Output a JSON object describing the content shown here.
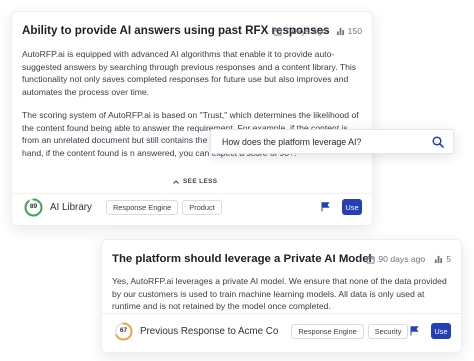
{
  "card1": {
    "title": "Ability to provide AI answers using past RFX responses",
    "date": "7 days ago",
    "usage_count": "150",
    "paragraph1": "AutoRFP.ai is equipped with advanced AI algorithms that enable it to provide auto-suggested answers by searching through previous responses and a content library. This functionality not only saves completed responses for future use but also improves and automates the process over time.",
    "paragraph2": "The scoring system of AutoRFP.ai is based on \"Trust,\" which determines the likelihood of the content found being able to answer the requirement. For example, if the content is from an unrelated document but still contains the necessary in around 10. On the other hand, if the content found is n answered, you can expect a score of 98+.",
    "see_less": "SEE LESS",
    "score": "89",
    "score_fraction": 0.89,
    "source": "AI Library",
    "tags": [
      "Response Engine",
      "Product"
    ],
    "use_label": "Use"
  },
  "search": {
    "query": "How does the platform leverage AI?"
  },
  "card2": {
    "title": "The platform should leverage a Private AI Model",
    "date": "90 days ago",
    "usage_count": "5",
    "paragraph": "Yes, AutoRFP.ai leverages a private AI model. We ensure that none of the data provided by our customers is used to train machine learning models. All data is only used at runtime and is not retained by the model once completed.",
    "score": "67",
    "score_fraction": 0.67,
    "source": "Previous Response to Acme Co",
    "tags": [
      "Response Engine",
      "Security"
    ],
    "use_label": "Use"
  },
  "colors": {
    "accent": "#2540b6",
    "score_high": "#3aa556",
    "score_mid": "#f0a53a",
    "score_track": "#e6e8ec"
  }
}
